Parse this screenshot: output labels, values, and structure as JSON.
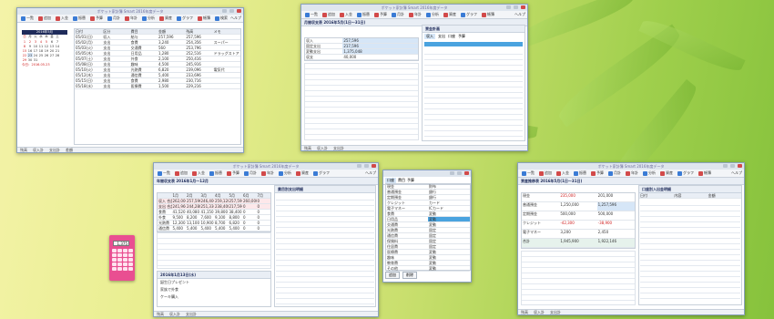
{
  "app": {
    "window_title": "ポケット家計簿 Smart 2016年度データ",
    "toolbar_items": [
      "一覧",
      "追加",
      "入金",
      "振替",
      "予算",
      "月計",
      "年計",
      "分析",
      "資産",
      "グラフ",
      "帳簿",
      "検索",
      "印刷",
      "ヘルプ"
    ],
    "colors": {
      "accent": "#4aa3df",
      "red": "#d02020",
      "title_bar": "#dfe6ee"
    }
  },
  "window_list": {
    "header_title": "2016年5月",
    "status_items": [
      "残高",
      "収入計",
      "支出計",
      "差額"
    ],
    "calendar": {
      "month_label": "2016年5月",
      "weekdays": [
        "日",
        "月",
        "火",
        "水",
        "木",
        "金",
        "土"
      ],
      "weeks": [
        [
          "1",
          "2",
          "3",
          "4",
          "5",
          "6",
          "7"
        ],
        [
          "8",
          "9",
          "10",
          "11",
          "12",
          "13",
          "14"
        ],
        [
          "15",
          "16",
          "17",
          "18",
          "19",
          "20",
          "21"
        ],
        [
          "22",
          "23",
          "24",
          "25",
          "26",
          "27",
          "28"
        ],
        [
          "29",
          "30",
          "31",
          "",
          "",
          "",
          ""
        ]
      ],
      "today_label": "今日：2016.05.23"
    },
    "columns": [
      "日付",
      "区分",
      "費目",
      "金額",
      "残高",
      "メモ"
    ],
    "rows": [
      [
        "05/01(日)",
        "収入",
        "給与",
        "257,596",
        "257,596",
        ""
      ],
      [
        "05/02(月)",
        "支出",
        "食費",
        "3,240",
        "254,356",
        "スーパー"
      ],
      [
        "05/03(火)",
        "支出",
        "交通費",
        "560",
        "253,796",
        ""
      ],
      [
        "05/05(木)",
        "支出",
        "日用品",
        "1,280",
        "252,516",
        "ドラッグストア"
      ],
      [
        "05/07(土)",
        "支出",
        "外食",
        "2,100",
        "250,416",
        ""
      ],
      [
        "05/08(日)",
        "支出",
        "趣味",
        "4,500",
        "245,916",
        ""
      ],
      [
        "05/10(火)",
        "支出",
        "光熱費",
        "6,820",
        "239,096",
        "電気代"
      ],
      [
        "05/12(木)",
        "支出",
        "通信費",
        "5,400",
        "233,696",
        ""
      ],
      [
        "05/15(日)",
        "支出",
        "食費",
        "2,980",
        "230,716",
        ""
      ],
      [
        "05/18(水)",
        "支出",
        "医療費",
        "1,500",
        "229,216",
        ""
      ]
    ]
  },
  "window_month": {
    "header_title": "月間収支表 2016年5月(1日〜31日)",
    "labels": [
      "収入",
      "固定支出",
      "変動支出",
      "収支"
    ],
    "values": [
      "257,596",
      "217,596",
      "1,375,048",
      "40,000"
    ],
    "right_head": "資金計画",
    "right_tabs": [
      "収入",
      "支出",
      "口座",
      "予算"
    ],
    "status_items": [
      "残高",
      "収入計",
      "支出計"
    ]
  },
  "window_year": {
    "header_title": "年間収支表 2016年1月〜12月",
    "months": [
      "1月",
      "2月",
      "3月",
      "4月",
      "5月",
      "6月",
      "7月"
    ],
    "rows": [
      [
        "収入 合計",
        "262,000",
        "257,596",
        "246,400",
        "259,120",
        "257,596",
        "260,000",
        "0"
      ],
      [
        "支出 合計",
        "241,960",
        "244,280",
        "251,336",
        "238,400",
        "217,596",
        "0",
        "0"
      ],
      [
        "食費",
        "41,520",
        "40,080",
        "41,150",
        "39,800",
        "38,400",
        "0",
        "0"
      ],
      [
        "外食",
        "9,500",
        "8,200",
        "7,600",
        "9,100",
        "8,800",
        "0",
        "0"
      ],
      [
        "光熱費",
        "12,300",
        "13,100",
        "10,900",
        "8,700",
        "6,820",
        "0",
        "0"
      ],
      [
        "通信費",
        "5,400",
        "5,400",
        "5,400",
        "5,400",
        "5,400",
        "0",
        "0"
      ]
    ],
    "right_head": "費目別支出明細",
    "memo_date": "2016年1月13日(水)",
    "memo_lines": [
      "誕生日プレゼント",
      "家族で外食",
      "ケーキ購入"
    ],
    "status_items": [
      "残高",
      "収入計",
      "支出計"
    ]
  },
  "window_accounts": {
    "tabs": [
      "口座",
      "費目",
      "予算"
    ],
    "items": [
      [
        "現金",
        "財布"
      ],
      [
        "普通預金",
        "銀行"
      ],
      [
        "定期預金",
        "銀行"
      ],
      [
        "クレジット",
        "カード"
      ],
      [
        "電子マネー",
        "ICカード"
      ],
      [
        "食費",
        "変動"
      ],
      [
        "日用品",
        "変動"
      ],
      [
        "交通費",
        "変動"
      ],
      [
        "光熱費",
        "固定"
      ],
      [
        "通信費",
        "固定"
      ],
      [
        "保険料",
        "固定"
      ],
      [
        "住居費",
        "固定"
      ],
      [
        "医療費",
        "変動"
      ],
      [
        "趣味",
        "変動"
      ],
      [
        "教育費",
        "変動"
      ],
      [
        "その他",
        "変動"
      ]
    ],
    "footer": [
      "追加",
      "削除"
    ]
  },
  "window_assets": {
    "header_title": "資産推移表 2016年5月(1日〜31日)",
    "rows": [
      [
        "現金",
        "235,000",
        "201,000"
      ],
      [
        "普通預金",
        "1,250,000",
        "1,257,596"
      ],
      [
        "定期預金",
        "500,000",
        "500,000"
      ],
      [
        "クレジット",
        "-42,300",
        "-38,900"
      ],
      [
        "電子マネー",
        "3,200",
        "2,450"
      ],
      [
        "合計",
        "1,945,900",
        "1,922,146"
      ]
    ],
    "right_head": "口座別入出金明細",
    "right_columns": [
      "日付",
      "内容",
      "金額"
    ],
    "status_items": [
      "残高",
      "収入計",
      "支出計"
    ]
  },
  "calculator": {
    "display": "1,375"
  }
}
